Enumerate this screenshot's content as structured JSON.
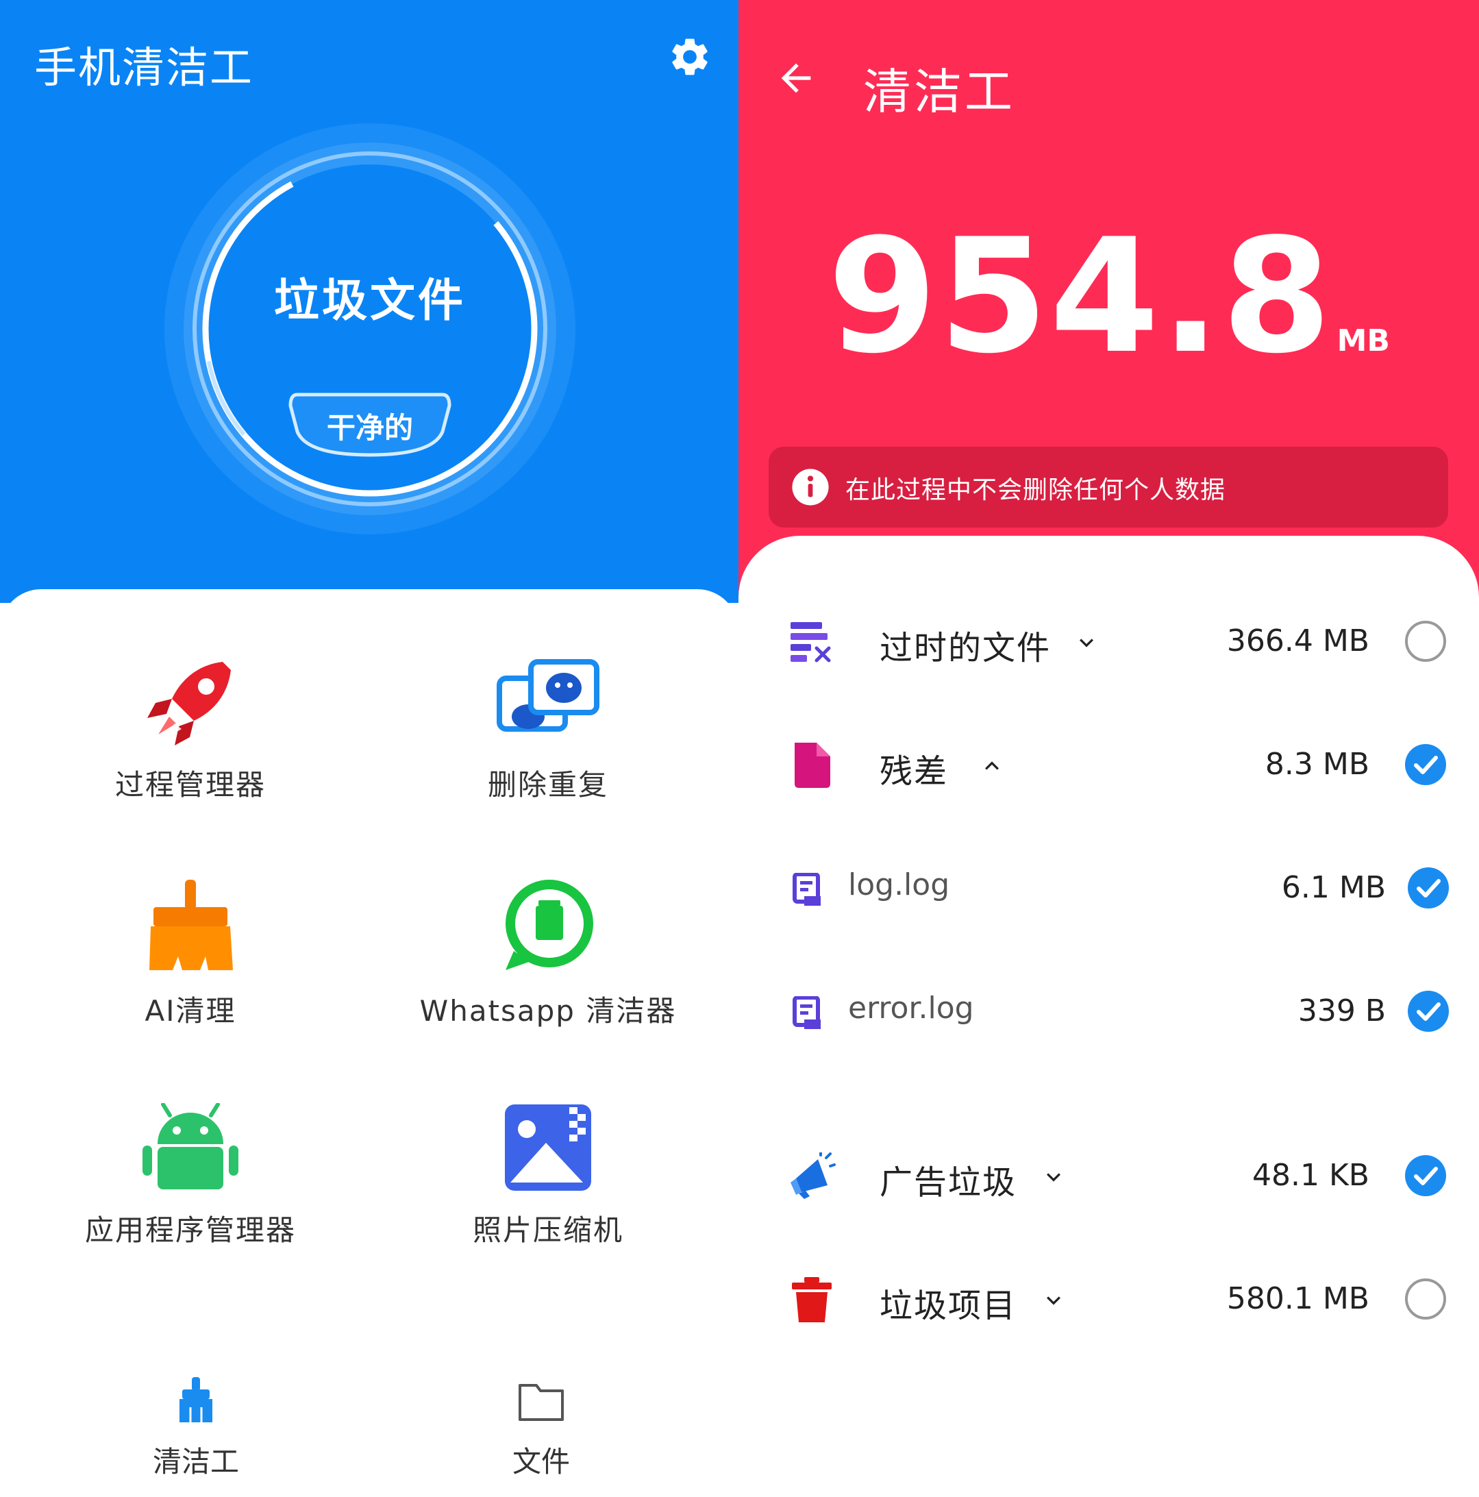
{
  "left": {
    "title": "手机清洁工",
    "gauge_label": "垃圾文件",
    "status": "干净的",
    "tiles": [
      {
        "label": "过程管理器",
        "icon": "rocket-icon"
      },
      {
        "label": "删除重复",
        "icon": "duplicate-photos-icon"
      },
      {
        "label": "AI清理",
        "icon": "broom-icon"
      },
      {
        "label": "Whatsapp 清洁器",
        "icon": "whatsapp-clean-icon"
      },
      {
        "label": "应用程序管理器",
        "icon": "android-icon"
      },
      {
        "label": "照片压缩机",
        "icon": "photo-zip-icon"
      }
    ],
    "nav": [
      {
        "label": "清洁工",
        "icon": "brush-icon",
        "active": true
      },
      {
        "label": "文件",
        "icon": "folder-icon",
        "active": false
      }
    ],
    "colors": {
      "header": "#0a84f5"
    }
  },
  "right": {
    "title": "清洁工",
    "total_value": "954.8",
    "total_unit": "MB",
    "notice": "在此过程中不会删除任何个人数据",
    "colors": {
      "header": "#fe2c55",
      "check": "#1a8cf0"
    },
    "items": [
      {
        "label": "过时的文件",
        "size": "366.4 MB",
        "checked": false,
        "icon": "obsolete-files-icon",
        "expand": "chevron-down-icon"
      },
      {
        "label": "残差",
        "size": "8.3 MB",
        "checked": true,
        "icon": "residual-file-icon",
        "expand": "chevron-up-icon"
      },
      {
        "label": "log.log",
        "size": "6.1 MB",
        "checked": true,
        "icon": "log-file-icon"
      },
      {
        "label": "error.log",
        "size": "339 B",
        "checked": true,
        "icon": "log-file-icon"
      },
      {
        "label": "广告垃圾",
        "size": "48.1 KB",
        "checked": true,
        "icon": "megaphone-icon",
        "expand": "chevron-down-icon"
      },
      {
        "label": "垃圾项目",
        "size": "580.1 MB",
        "checked": false,
        "icon": "trash-icon",
        "expand": "chevron-down-icon"
      }
    ]
  }
}
